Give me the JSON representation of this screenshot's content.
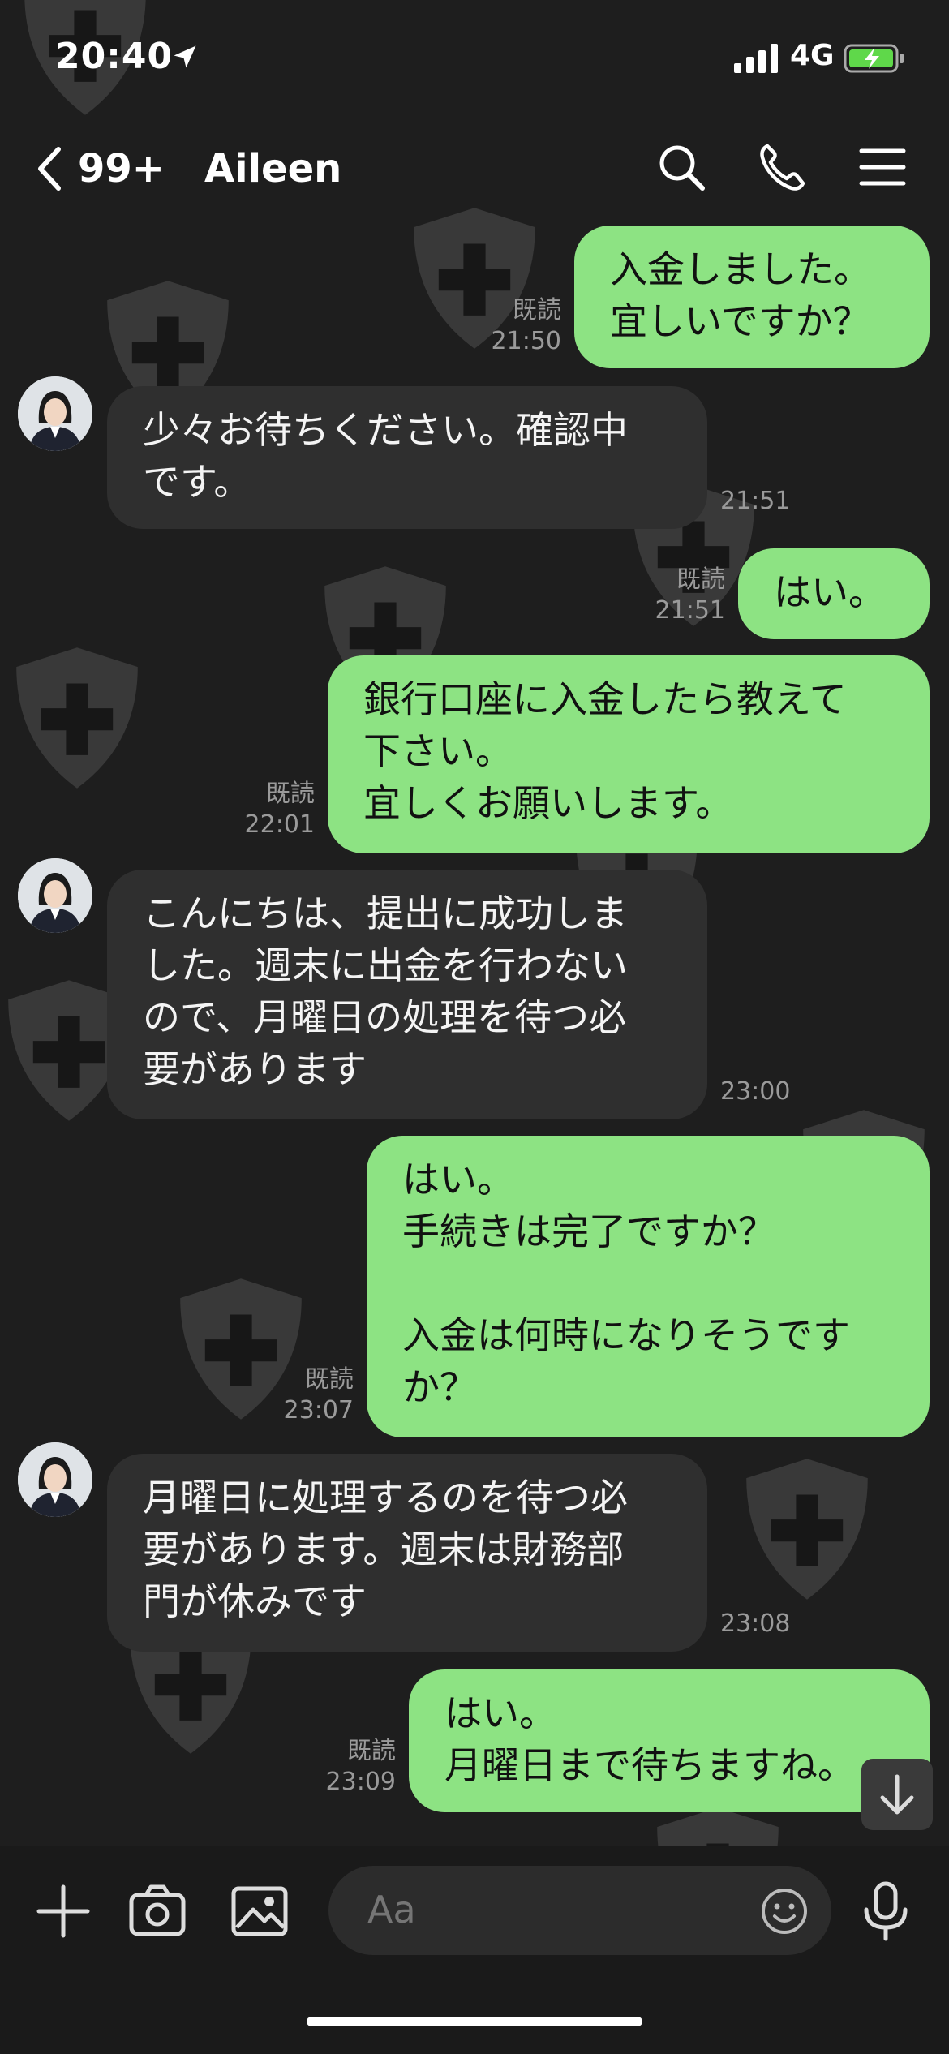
{
  "status": {
    "time": "20:40",
    "network": "4G"
  },
  "header": {
    "unread": "99+",
    "title": "Aileen"
  },
  "messages": [
    {
      "dir": "out",
      "text": "入金しました。\n宜しいですか？",
      "read": "既読",
      "time": "21:50"
    },
    {
      "dir": "in",
      "text": "少々お待ちください。確認中\nです。",
      "time": "21:51"
    },
    {
      "dir": "out",
      "text": "はい。",
      "read": "既読",
      "time": "21:51"
    },
    {
      "dir": "out",
      "text": "銀行口座に入金したら教えて\n下さい。\n宜しくお願いします。",
      "read": "既読",
      "time": "22:01"
    },
    {
      "dir": "in",
      "text": "こんにちは、提出に成功しま\nした。週末に出金を行わない\nので、月曜日の処理を待つ必\n要があります",
      "time": "23:00"
    },
    {
      "dir": "out",
      "text": "はい。\n手続きは完了ですか？\n\n入金は何時になりそうです\nか？",
      "read": "既読",
      "time": "23:07"
    },
    {
      "dir": "in",
      "text": "月曜日に処理するのを待つ必\n要があります。週末は財務部\n門が休みです",
      "time": "23:08"
    },
    {
      "dir": "out",
      "text": "はい。\n月曜日まで待ちますね。",
      "read": "既読",
      "time": "23:09"
    }
  ],
  "input": {
    "placeholder": "Aa"
  },
  "icons": {
    "back": "chevron-left-icon",
    "search": "search-icon",
    "call": "phone-icon",
    "menu": "menu-icon",
    "plus": "plus-icon",
    "camera": "camera-icon",
    "image": "image-icon",
    "emoji": "emoji-icon",
    "mic": "mic-icon",
    "scroll": "arrow-down-icon",
    "watermark": "shield-cross-icon"
  },
  "colors": {
    "background": "#1e1e1e",
    "outgoing": "#8de383",
    "incoming": "#2f2f2f",
    "meta": "#9a9a9a"
  }
}
